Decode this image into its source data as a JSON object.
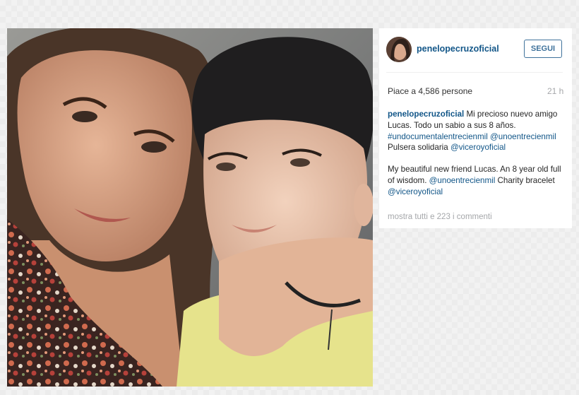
{
  "post": {
    "username": "penelopecruzoficial",
    "follow_label": "SEGUI",
    "likes_text": "Piace a 4,586 persone",
    "time_ago": "21 h",
    "caption": {
      "username": "penelopecruzoficial",
      "text1": "Mi precioso nuevo amigo Lucas. Todo un sabio a sus 8 años.",
      "hashtag": "#undocumentalentrecienmil",
      "mention1": "@unoentrecienmil",
      "text2": "Pulsera solidaria",
      "mention2": "@viceroyoficial",
      "en_text1": "My beautiful new friend Lucas. An 8 year old full of wisdom.",
      "en_mention1": "@unoentrecienmil",
      "en_text2": "Charity bracelet",
      "en_mention2": "@viceroyoficial"
    },
    "comments_link": "mostra tutti e 223 i commenti"
  },
  "colors": {
    "link": "#125688",
    "follow_border": "#3f729b",
    "muted": "#a5a7aa"
  }
}
